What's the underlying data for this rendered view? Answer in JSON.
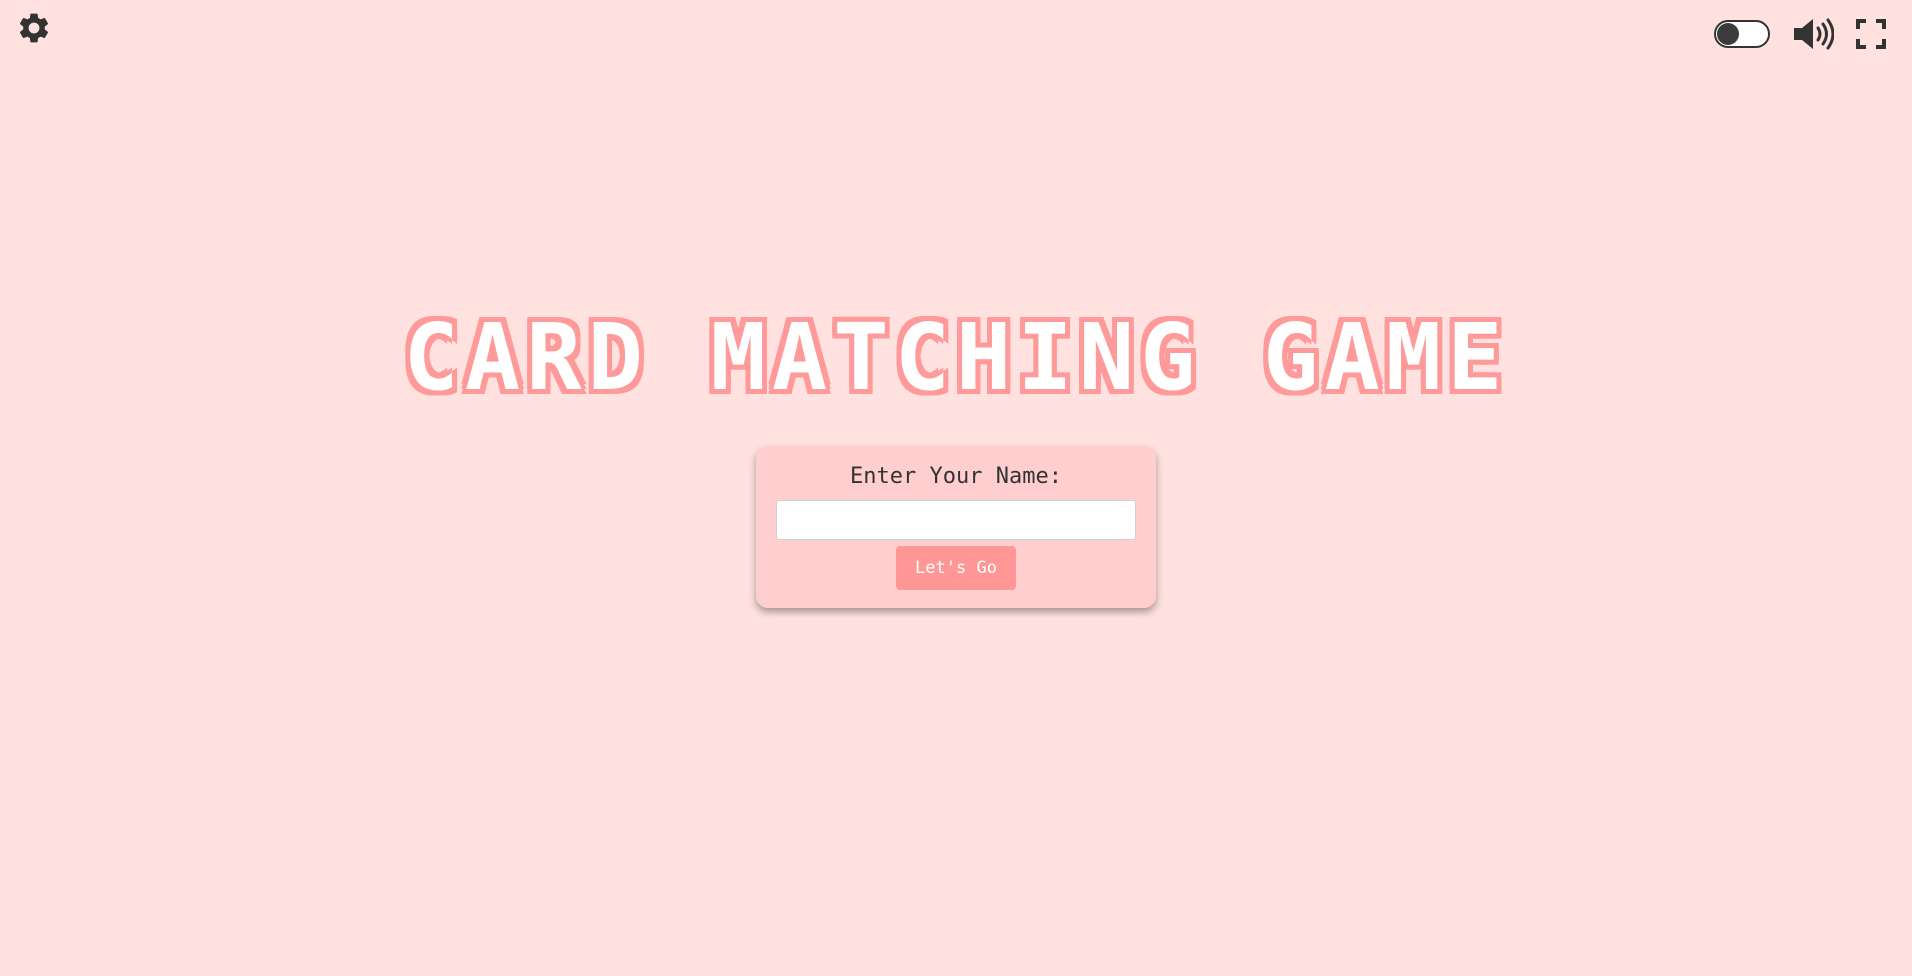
{
  "game": {
    "title": "CARD MATCHING GAME"
  },
  "toolbar": {
    "settings_icon": "gear-icon",
    "theme_toggle_on": false,
    "sound_icon": "volume-icon",
    "fullscreen_icon": "fullscreen-icon"
  },
  "name_form": {
    "label": "Enter Your Name:",
    "input_value": "",
    "button_label": "Let's Go"
  },
  "colors": {
    "background": "#ffe2df",
    "card": "#ffcfd0",
    "accent": "#ff9797",
    "title_outline": "#ff9a9a",
    "icon": "#333333"
  }
}
